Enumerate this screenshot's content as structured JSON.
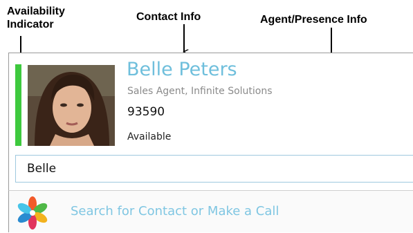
{
  "labels": {
    "availability": "Availability Indicator",
    "contact": "Contact Info",
    "agent": "Agent/Presence Info"
  },
  "contact": {
    "name": "Belle Peters",
    "title": "Sales Agent, Infinite Solutions",
    "extension": "93590",
    "status": "Available",
    "status_color": "#3ec93e"
  },
  "search": {
    "value": "Belle"
  },
  "call_bar": {
    "label": "Search for Contact or Make a Call"
  },
  "icons": {
    "logo": "pinwheel-logo-icon",
    "avatar": "contact-photo"
  },
  "colors": {
    "name": "#6fbfdc",
    "link": "#7fc6e2",
    "input_border": "#9ec8df"
  }
}
